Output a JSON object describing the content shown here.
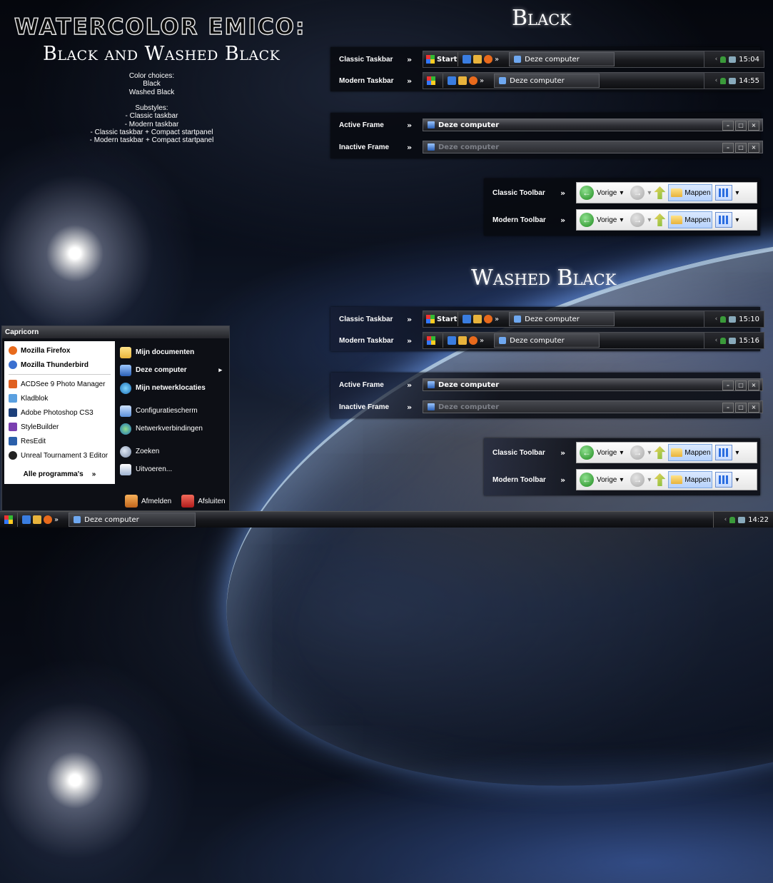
{
  "header": {
    "title": "Watercolor Emico:",
    "subtitle": "Black and Washed Black",
    "info": [
      "Color choices:",
      "Black",
      "Washed Black",
      "",
      "Substyles:",
      "- Classic taskbar",
      "- Modern taskbar",
      "- Classic taskbar + Compact startpanel",
      "- Modern taskbar + Compact startpanel"
    ]
  },
  "sections": {
    "black": "Black",
    "washed": "Washed Black"
  },
  "labels": {
    "classic_taskbar": "Classic Taskbar",
    "modern_taskbar": "Modern Taskbar",
    "active_frame": "Active Frame",
    "inactive_frame": "Inactive Frame",
    "classic_toolbar": "Classic Toolbar",
    "modern_toolbar": "Modern Toolbar",
    "arrow": "»"
  },
  "taskbar": {
    "start_label": "Start",
    "task_label": "Deze computer",
    "chevron": "»"
  },
  "clocks": {
    "black_classic": "15:04",
    "black_modern": "14:55",
    "washed_classic": "15:10",
    "washed_modern": "15:16",
    "bottom": "14:22"
  },
  "frame": {
    "title": "Deze computer",
    "min": "–",
    "max": "□",
    "close": "×"
  },
  "toolbar": {
    "back_label": "Vorige",
    "dropdown": "▾",
    "folders_label": "Mappen"
  },
  "startmenu": {
    "user": "Capricorn",
    "pinned": [
      "Mozilla Firefox",
      "Mozilla Thunderbird"
    ],
    "recent": [
      "ACDSee 9 Photo Manager",
      "Kladblok",
      "Adobe Photoshop CS3",
      "StyleBuilder",
      "ResEdit",
      "Unreal Tournament 3 Editor"
    ],
    "all_programs": "Alle programma's",
    "right": [
      "Mijn documenten",
      "Deze computer",
      "Mijn netwerklocaties",
      "Configuratiescherm",
      "Netwerkverbindingen",
      "Zoeken",
      "Uitvoeren..."
    ],
    "logoff": "Afmelden",
    "shutdown": "Afsluiten"
  },
  "bottombar": {
    "task_label": "Deze computer"
  },
  "colors": {
    "accent_blue": "#2b6de0",
    "go_green": "#1f8a1f",
    "folder_highlight": "#b7d2fb"
  }
}
